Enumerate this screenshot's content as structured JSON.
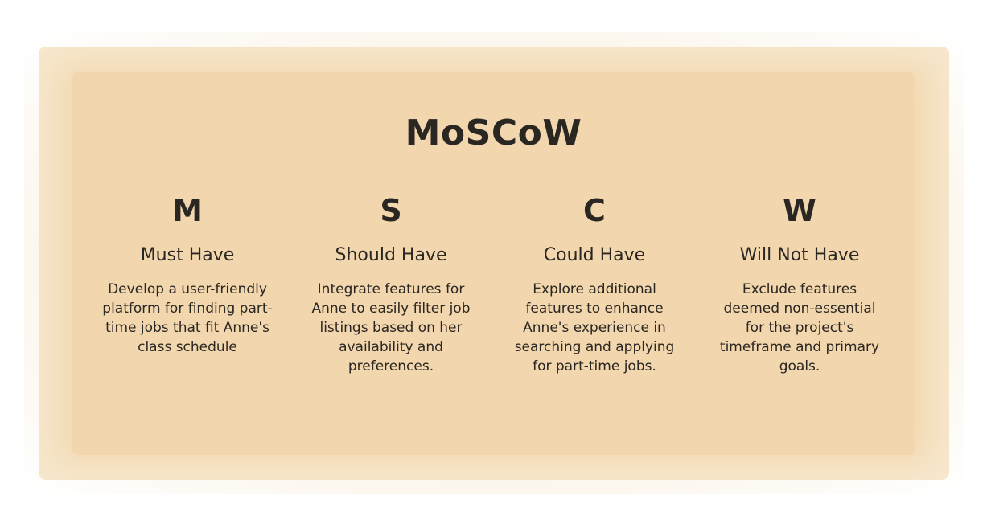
{
  "title": "MoSCoW",
  "columns": [
    {
      "letter": "M",
      "heading": "Must Have",
      "description": "Develop a user-friendly platform for finding part-time jobs that fit Anne's class schedule"
    },
    {
      "letter": "S",
      "heading": "Should Have",
      "description": "Integrate features for Anne to easily filter job listings based on her availability and preferences."
    },
    {
      "letter": "C",
      "heading": "Could Have",
      "description": "Explore additional features to enhance Anne's experience in searching and applying for part-time jobs."
    },
    {
      "letter": "W",
      "heading": "Will Not Have",
      "description": "Exclude features deemed non-essential for the project's timeframe and primary goals."
    }
  ],
  "colors": {
    "outer_card": "#f2d9b1",
    "inner_card": "#f2d6ad",
    "text": "#2a2622"
  }
}
